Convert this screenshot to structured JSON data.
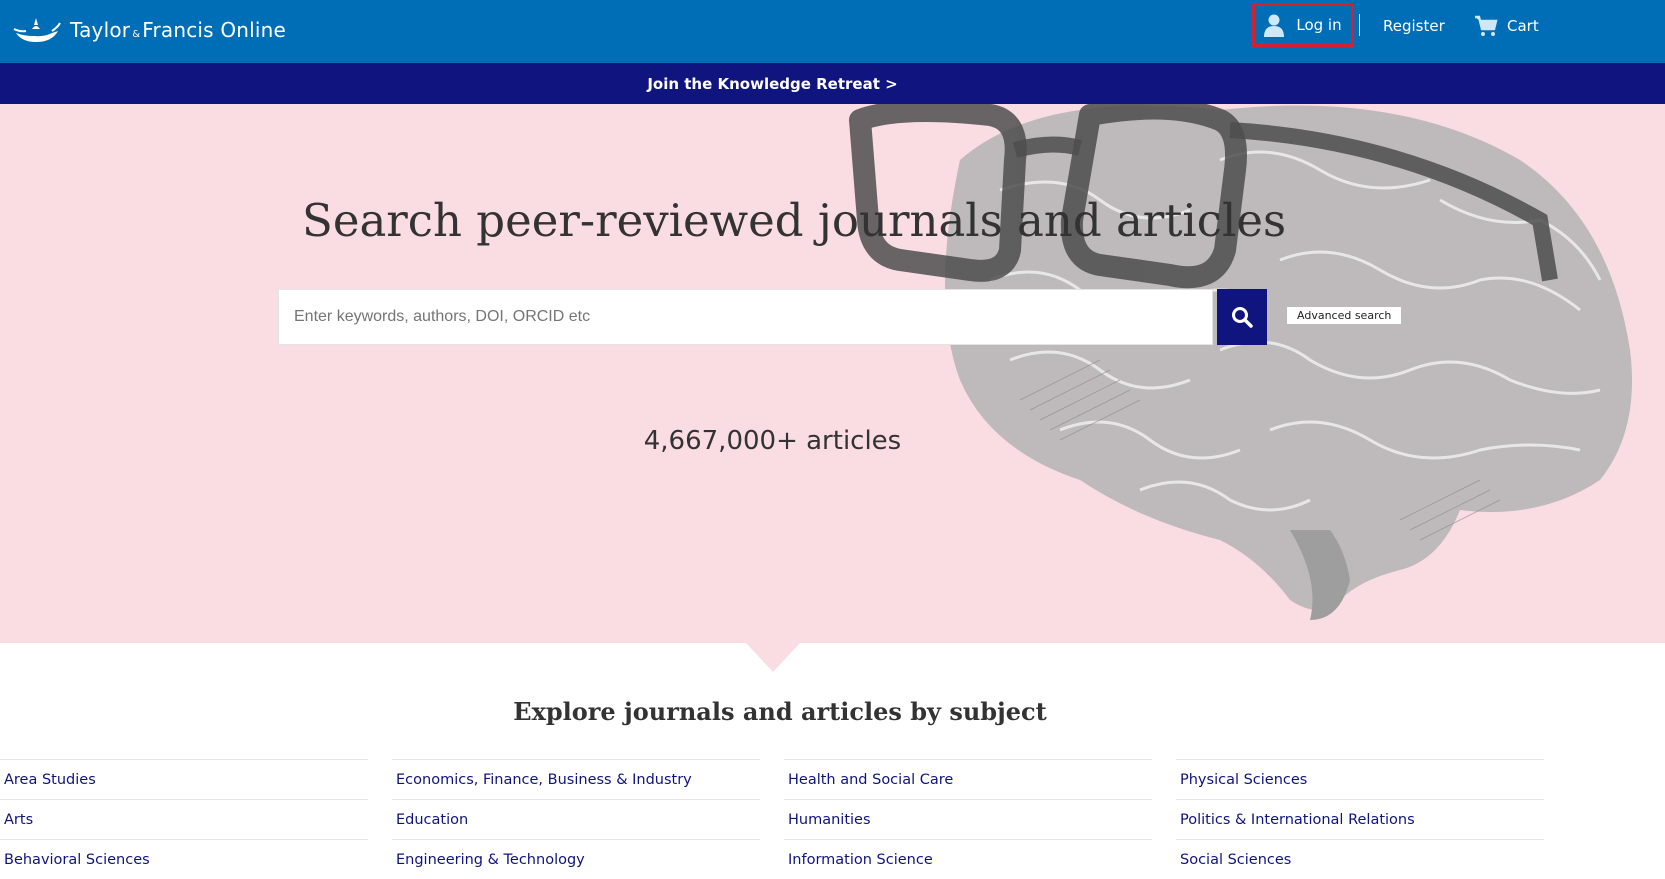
{
  "header": {
    "logo_main": "Taylor",
    "logo_amp": "&",
    "logo_rest": "Francis Online",
    "login_label": "Log in",
    "register_label": "Register",
    "cart_label": "Cart",
    "brand_color": "#006db7",
    "highlight_color": "#d62030"
  },
  "banner": {
    "text": "Join the Knowledge Retreat >",
    "color": "#10147e"
  },
  "hero": {
    "title": "Search peer-reviewed journals and articles",
    "search_placeholder": "Enter keywords, authors, DOI, ORCID etc",
    "search_value": "",
    "advanced_search_label": "Advanced search",
    "article_count": "4,667,000+ articles",
    "background": "#fadde3"
  },
  "subjects": {
    "title": "Explore journals and articles by subject",
    "columns": [
      [
        "Area Studies",
        "Arts",
        "Behavioral Sciences"
      ],
      [
        "Economics, Finance, Business & Industry",
        "Education",
        "Engineering & Technology"
      ],
      [
        "Health and Social Care",
        "Humanities",
        "Information Science"
      ],
      [
        "Physical Sciences",
        "Politics & International Relations",
        "Social Sciences"
      ]
    ]
  }
}
